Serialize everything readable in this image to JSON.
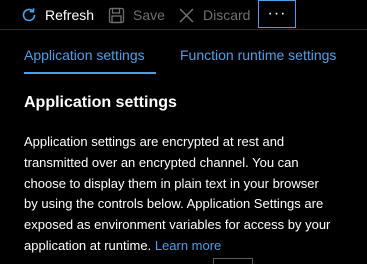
{
  "toolbar": {
    "refresh_label": "Refresh",
    "refresh_icon": "refresh-icon",
    "save_label": "Save",
    "save_icon": "save-icon",
    "discard_label": "Discard",
    "discard_icon": "close-icon",
    "more_label": "···",
    "more_icon": "more-icon"
  },
  "tabs": [
    {
      "label": "Application settings",
      "selected": true
    },
    {
      "label": "Function runtime settings",
      "selected": false
    }
  ],
  "section": {
    "heading": "Application settings",
    "description_lines": [
      "Application settings are encrypted at rest and",
      "transmitted over an encrypted channel. You can",
      "choose to display them in plain text in your browser",
      "by using the controls below. Application Settings are",
      "exposed as environment variables for access by your",
      "application at runtime."
    ],
    "learn_more": "Learn more"
  },
  "colors": {
    "background": "#000000",
    "accent": "#4aa0e6",
    "text": "#ffffff",
    "disabled": "#6f6f6f"
  }
}
